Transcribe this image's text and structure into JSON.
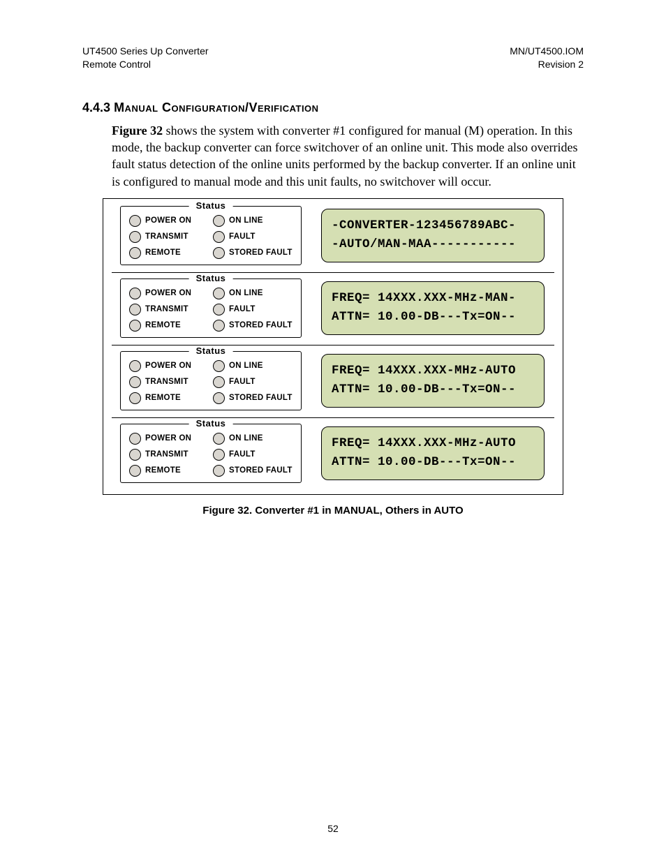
{
  "header": {
    "left1": "UT4500 Series Up Converter",
    "left2": "Remote Control",
    "right1": "MN/UT4500.IOM",
    "right2": "Revision 2"
  },
  "section": {
    "num": "4.4.3",
    "title": "Manual Configuration/Verification"
  },
  "paragraph": {
    "lead": "Figure 32",
    "rest": " shows the system with converter #1 configured for manual (M) operation.  In this mode, the backup converter can force switchover of an online unit.  This mode also overrides fault status detection of the online units performed by the backup converter.  If  an online unit is configured to manual mode and this unit faults, no switchover will occur."
  },
  "status_legend": "Status",
  "led_labels": {
    "power_on": "POWER ON",
    "on_line": "ON LINE",
    "transmit": "TRANSMIT",
    "fault": "FAULT",
    "remote": "REMOTE",
    "stored_fault": "STORED FAULT"
  },
  "lcds": {
    "u1l1": "-CONVERTER-123456789ABC-",
    "u1l2": "-AUTO/MAN-MAA-----------",
    "u2l1": "FREQ= 14XXX.XXX-MHz-MAN-",
    "u2l2": "ATTN= 10.00-DB---Tx=ON--",
    "u3l1": "FREQ= 14XXX.XXX-MHz-AUTO",
    "u3l2": "ATTN= 10.00-DB---Tx=ON--",
    "u4l1": "FREQ= 14XXX.XXX-MHz-AUTO",
    "u4l2": "ATTN= 10.00-DB---Tx=ON--"
  },
  "caption": "Figure 32.  Converter #1 in MANUAL, Others in AUTO",
  "page_number": "52"
}
